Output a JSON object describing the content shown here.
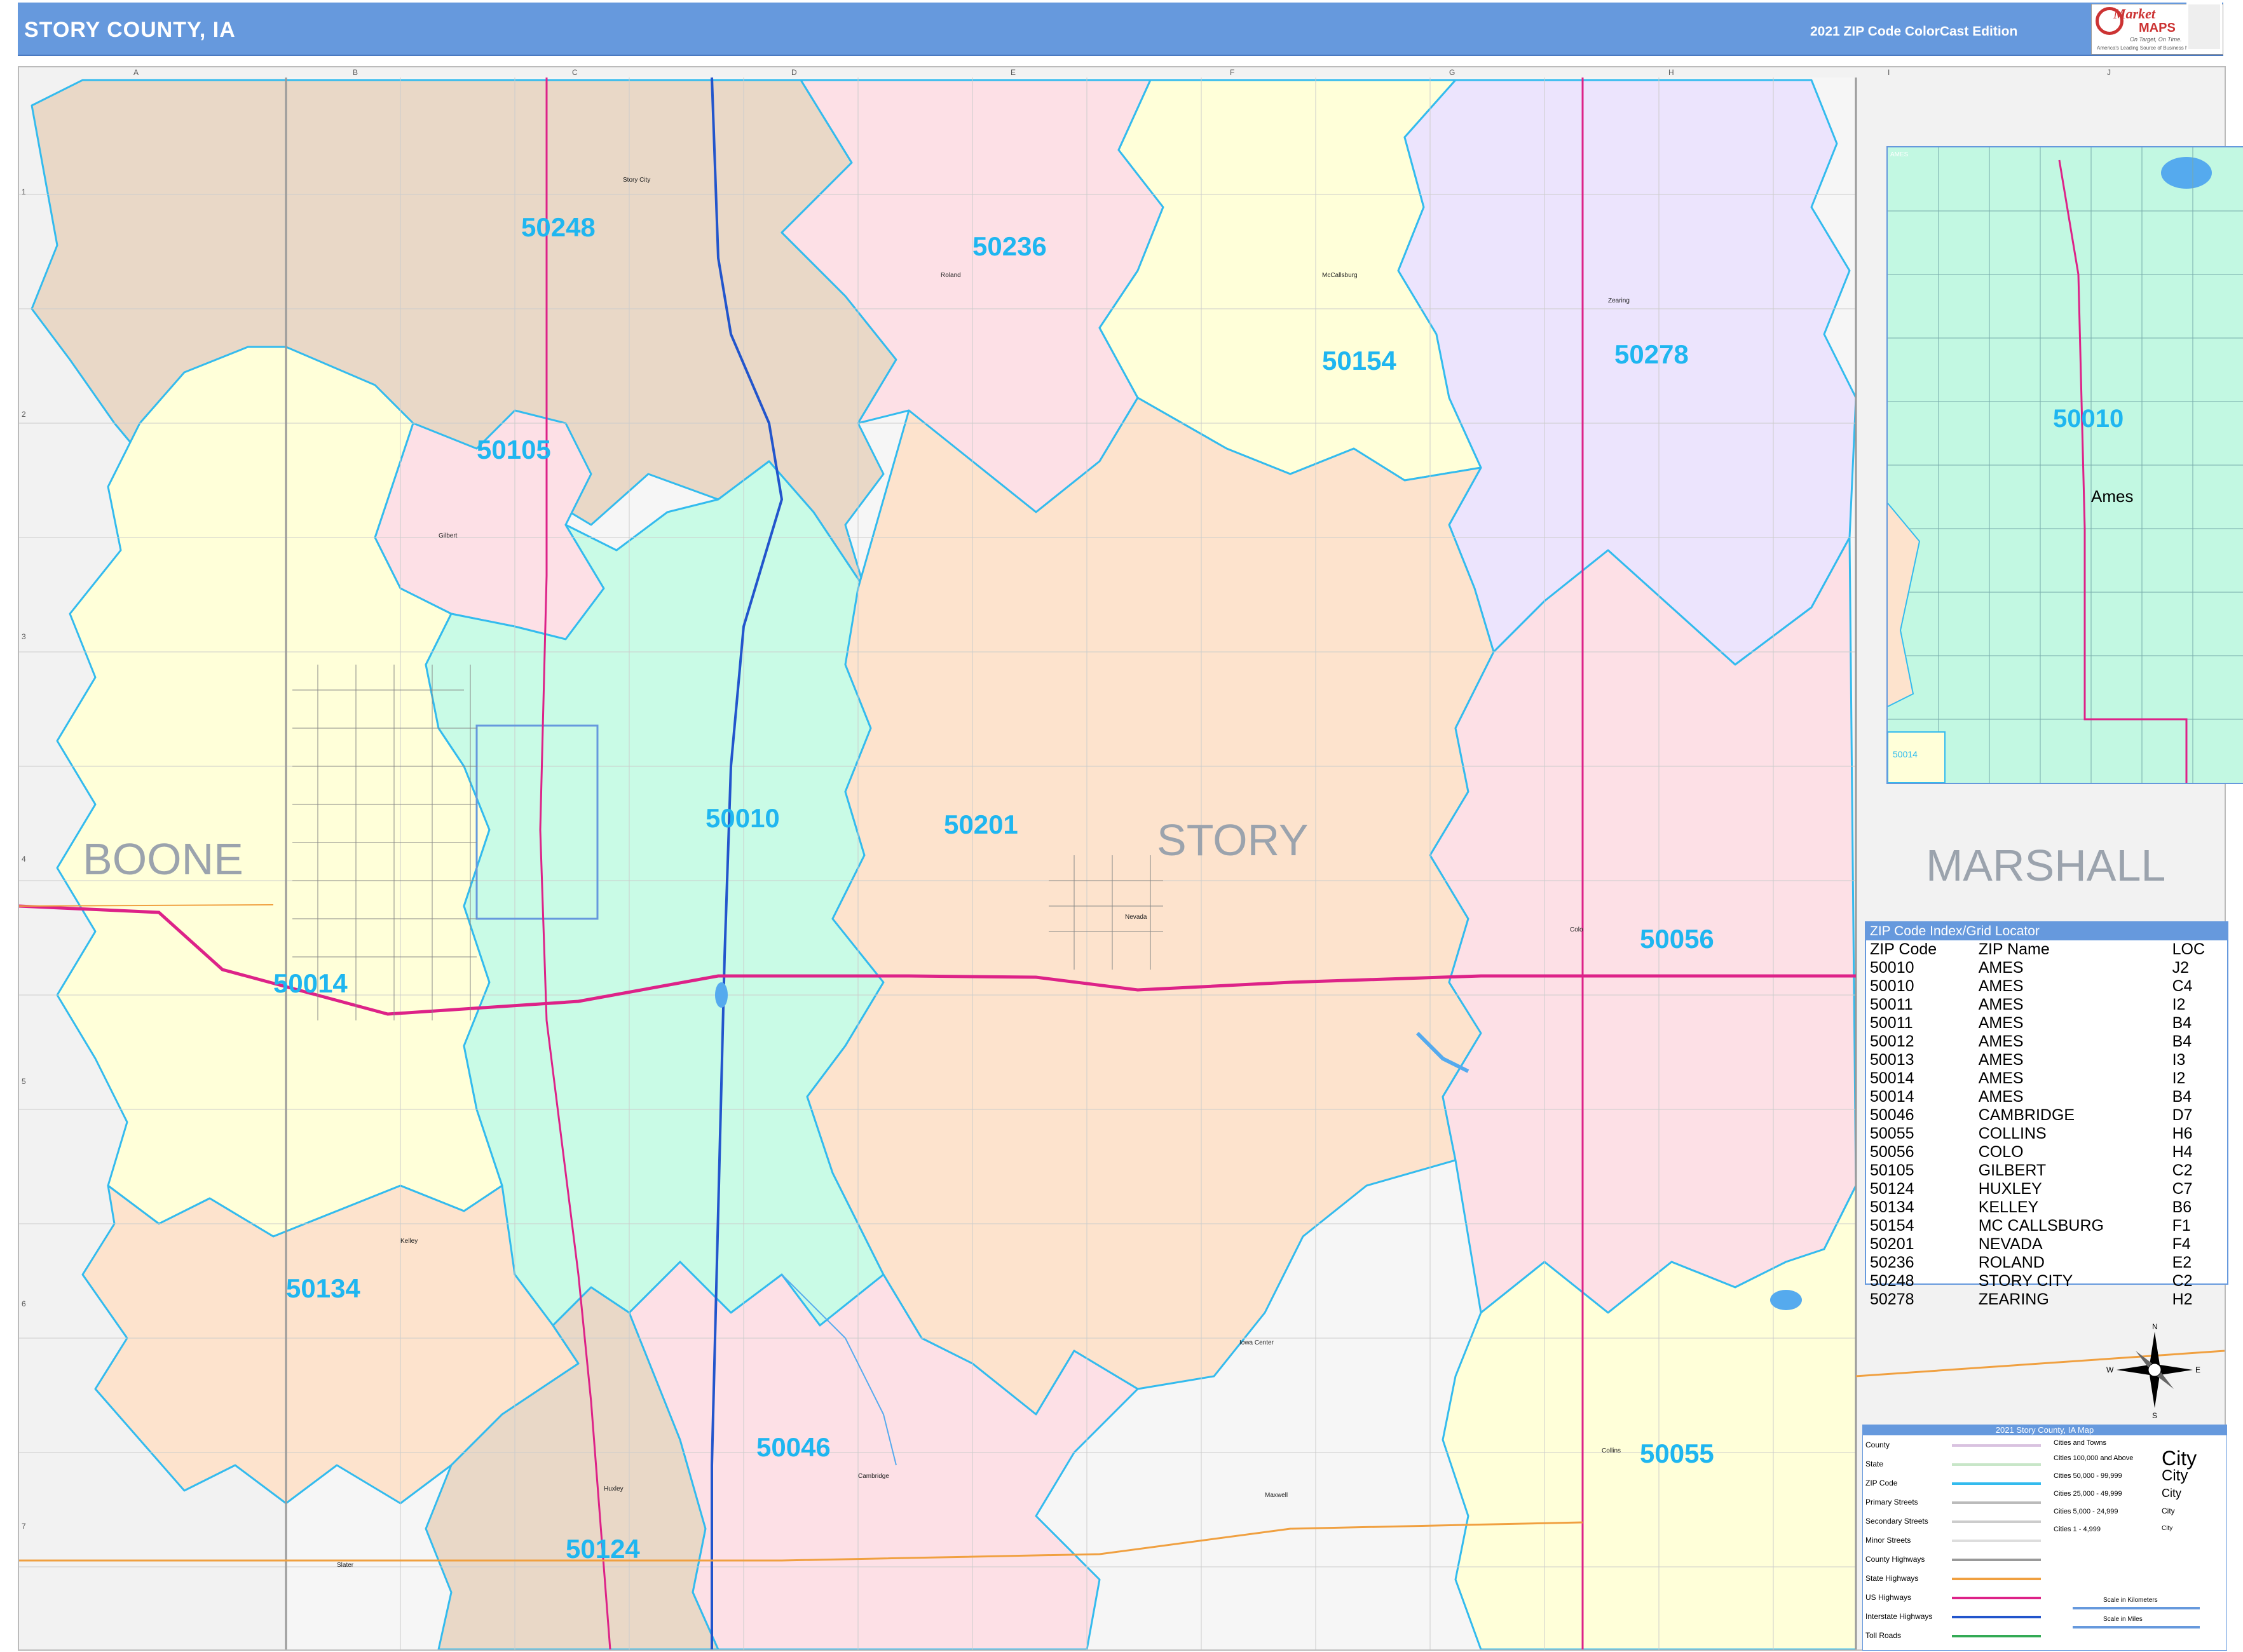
{
  "header": {
    "title": "STORY COUNTY, IA",
    "edition": "2021 ZIP Code ColorCast Edition",
    "logo_word1": "Market",
    "logo_word2": "MAPS",
    "logo_tagline": "On Target, On Time.",
    "logo_sub": "America's Leading Source of Business Maps"
  },
  "colors": {
    "header_bg": "#6699dd",
    "zip_label": "#1fb6f0",
    "zip_border": "#33bbee",
    "interstate": "#2255cc",
    "us_highway": "#dd2288",
    "state_highway": "#f0a040",
    "county_label": "#9ba3ad"
  },
  "grid": {
    "columns": [
      "A",
      "B",
      "C",
      "D",
      "E",
      "F",
      "G",
      "H",
      "I",
      "J"
    ],
    "rows": [
      "1",
      "2",
      "3",
      "4",
      "5",
      "6",
      "7"
    ]
  },
  "counties": {
    "boone": "BOONE",
    "story": "STORY",
    "marshall": "MARSHALL"
  },
  "zips": [
    {
      "code": "50248"
    },
    {
      "code": "50236"
    },
    {
      "code": "50154"
    },
    {
      "code": "50278"
    },
    {
      "code": "50105"
    },
    {
      "code": "50010"
    },
    {
      "code": "50201"
    },
    {
      "code": "50056"
    },
    {
      "code": "50014"
    },
    {
      "code": "50134"
    },
    {
      "code": "50046"
    },
    {
      "code": "50055"
    },
    {
      "code": "50124"
    }
  ],
  "places": {
    "story_city": "Story City",
    "roland": "Roland",
    "mccallsburg": "McCallsburg",
    "zearing": "Zearing",
    "gilbert": "Gilbert",
    "nevada": "Nevada",
    "colo": "Colo",
    "kelley": "Kelley",
    "iowa_center": "Iowa Center",
    "cambridge": "Cambridge",
    "collins": "Collins",
    "huxley": "Huxley",
    "maxwell": "Maxwell",
    "slater": "Slater"
  },
  "inset": {
    "title": "AMES",
    "zip": "50010",
    "city": "Ames",
    "zip2": "50014"
  },
  "index": {
    "title": "ZIP Code Index/Grid Locator",
    "headers": [
      "ZIP Code",
      "ZIP Name",
      "LOC"
    ],
    "rows": [
      [
        "50010",
        "AMES",
        "J2"
      ],
      [
        "50010",
        "AMES",
        "C4"
      ],
      [
        "50011",
        "AMES",
        "I2"
      ],
      [
        "50011",
        "AMES",
        "B4"
      ],
      [
        "50012",
        "AMES",
        "B4"
      ],
      [
        "50013",
        "AMES",
        "I3"
      ],
      [
        "50014",
        "AMES",
        "I2"
      ],
      [
        "50014",
        "AMES",
        "B4"
      ],
      [
        "50046",
        "CAMBRIDGE",
        "D7"
      ],
      [
        "50055",
        "COLLINS",
        "H6"
      ],
      [
        "50056",
        "COLO",
        "H4"
      ],
      [
        "50105",
        "GILBERT",
        "C2"
      ],
      [
        "50124",
        "HUXLEY",
        "C7"
      ],
      [
        "50134",
        "KELLEY",
        "B6"
      ],
      [
        "50154",
        "MC CALLSBURG",
        "F1"
      ],
      [
        "50201",
        "NEVADA",
        "F4"
      ],
      [
        "50236",
        "ROLAND",
        "E2"
      ],
      [
        "50248",
        "STORY CITY",
        "C2"
      ],
      [
        "50278",
        "ZEARING",
        "H2"
      ]
    ]
  },
  "legend": {
    "title": "2021 Story County, IA Map",
    "items": [
      "County",
      "State",
      "ZIP Code",
      "Primary Streets",
      "Secondary Streets",
      "Minor Streets",
      "County Highways",
      "State Highways",
      "US Highways",
      "Interstate Highways",
      "Toll Roads"
    ],
    "city_title": "Cities and Towns",
    "city_tiers": [
      "Cities 100,000 and Above",
      "Cities 50,000 - 99,999",
      "Cities 25,000 - 49,999",
      "Cities 5,000 - 24,999",
      "Cities 1 - 4,999"
    ],
    "city_samples": [
      "City",
      "City",
      "City",
      "City",
      "City"
    ],
    "scale_km": "Scale in Kilometers",
    "scale_mi": "Scale in Miles"
  },
  "compass": {
    "n": "N",
    "s": "S",
    "e": "E",
    "w": "W"
  }
}
